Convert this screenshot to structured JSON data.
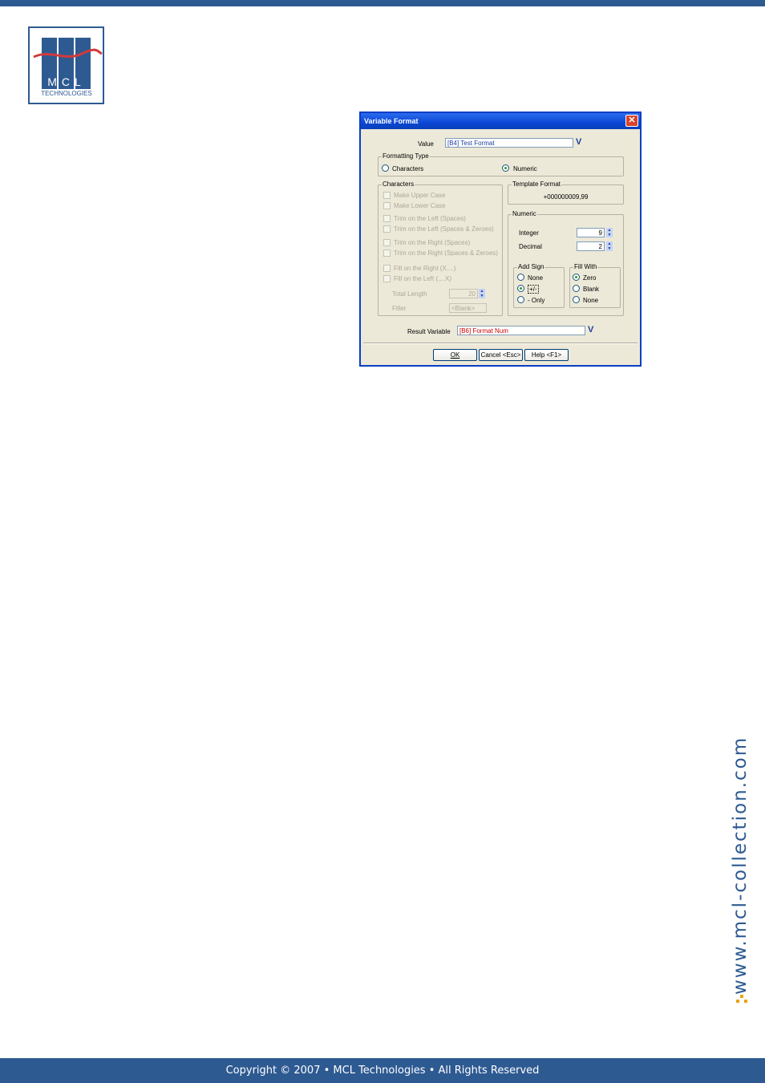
{
  "logo": {
    "text": "MCL",
    "subtext": "TECHNOLOGIES"
  },
  "dialog": {
    "title": "Variable Format",
    "value_label": "Value",
    "value_field": "[B4] Test Format",
    "formatting_type": {
      "label": "Formatting Type",
      "option_characters": "Characters",
      "option_numeric": "Numeric"
    },
    "characters": {
      "label": "Characters",
      "make_upper": "Make Upper Case",
      "make_lower": "Make Lower Case",
      "trim_left_spaces": "Trim on the Left (Spaces)",
      "trim_left_spaces_zeroes": "Trim on the Left (Spaces & Zeroes)",
      "trim_right_spaces": "Trim on the Right (Spaces)",
      "trim_right_spaces_zeroes": "Trim on the Right (Spaces & Zeroes)",
      "fill_right": "Fill on the Right (X....)",
      "fill_left": "Fill on the Left (....X)",
      "total_length_label": "Total Length",
      "total_length_value": "20",
      "filler_label": "Filler",
      "filler_value": "<Blank>"
    },
    "template_format": {
      "label": "Template Format",
      "value": "+000000009,99"
    },
    "numeric": {
      "label": "Numeric",
      "integer_label": "Integer",
      "integer_value": "9",
      "decimal_label": "Decimal",
      "decimal_value": "2",
      "add_sign": {
        "label": "Add Sign",
        "none": "None",
        "plus_minus": "+/-",
        "minus_only": "- Only"
      },
      "fill_with": {
        "label": "Fill With",
        "zero": "Zero",
        "blank": "Blank",
        "none": "None"
      }
    },
    "result_label": "Result Variable",
    "result_field": "[B6] Format Num",
    "buttons": {
      "ok": "OK",
      "cancel": "Cancel <Esc>",
      "help": "Help <F1>"
    }
  },
  "side_url": "www.mcl-collection.com",
  "footer": "Copyright © 2007 • MCL Technologies • All Rights Reserved",
  "colors": {
    "brand": "#2e5a92",
    "accent": "#e8a317",
    "logo_red": "#d23a3a"
  }
}
